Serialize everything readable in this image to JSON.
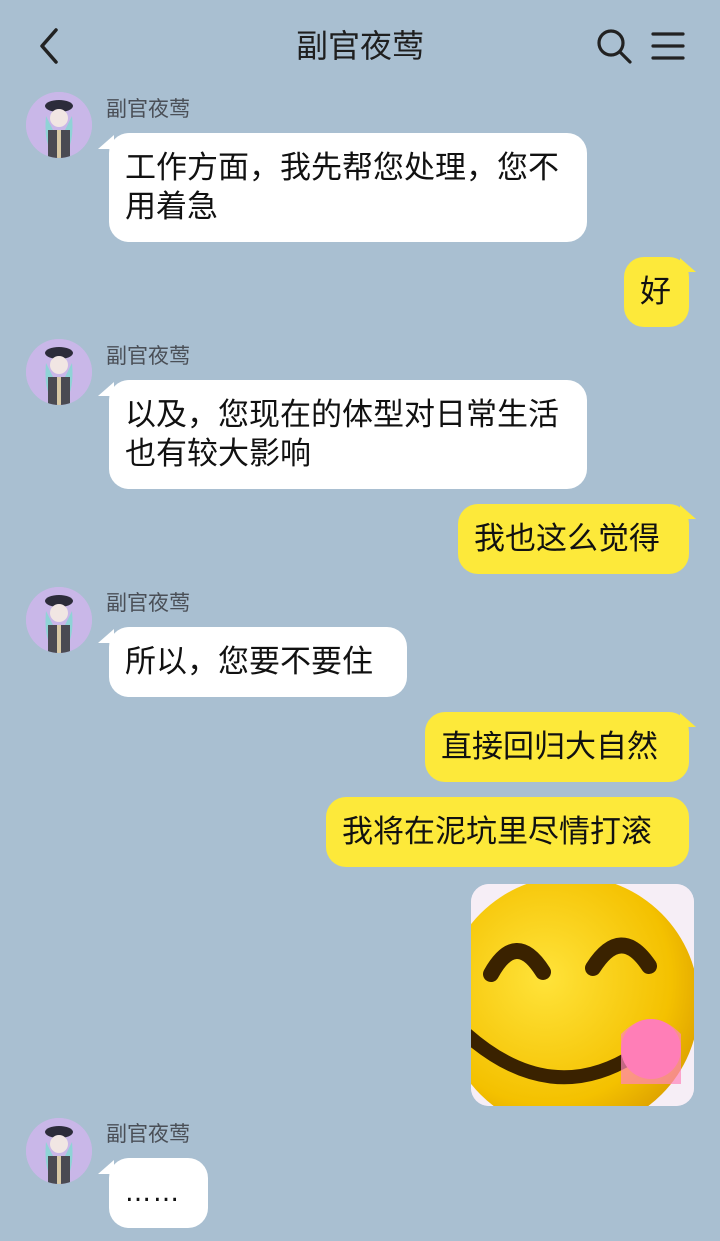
{
  "header": {
    "title": "副官夜莺",
    "back_icon": "back-arrow-icon",
    "search_icon": "search-icon",
    "menu_icon": "menu-icon"
  },
  "messages": [
    {
      "side": "left",
      "sender": "副官夜莺",
      "text": "工作方面，我先帮您处理，您不用着急"
    },
    {
      "side": "right",
      "text": "好"
    },
    {
      "side": "left",
      "sender": "副官夜莺",
      "text": "以及，您现在的体型对日常生活也有较大影响"
    },
    {
      "side": "right",
      "text": "我也这么觉得"
    },
    {
      "side": "left",
      "sender": "副官夜莺",
      "text": "所以，您要不要住"
    },
    {
      "side": "right",
      "text": "直接回归大自然"
    },
    {
      "side": "right",
      "text": "我将在泥坑里尽情打滚"
    },
    {
      "side": "right",
      "sticker": "smiling-emoji-sticker"
    },
    {
      "side": "left",
      "sender": "副官夜莺",
      "text": "……"
    }
  ],
  "colors": {
    "background": "#a9bfd1",
    "incoming_bubble": "#ffffff",
    "outgoing_bubble": "#fde93a"
  }
}
